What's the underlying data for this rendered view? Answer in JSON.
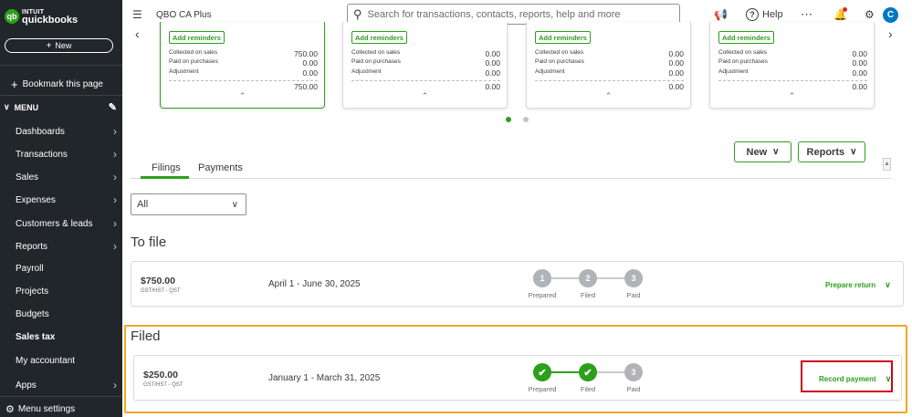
{
  "sidebar": {
    "logo_line1": "INTUIT",
    "logo_line2": "quickbooks",
    "logo_mark": "qb",
    "new_label": "New",
    "bookmark_label": "Bookmark this page",
    "menu_label": "MENU",
    "items": [
      {
        "label": "Dashboards",
        "has_arrow": true
      },
      {
        "label": "Transactions",
        "has_arrow": true
      },
      {
        "label": "Sales",
        "has_arrow": true
      },
      {
        "label": "Expenses",
        "has_arrow": true
      },
      {
        "label": "Customers & leads",
        "has_arrow": true
      },
      {
        "label": "Reports",
        "has_arrow": true
      },
      {
        "label": "Payroll",
        "has_arrow": false
      },
      {
        "label": "Projects",
        "has_arrow": false
      },
      {
        "label": "Budgets",
        "has_arrow": false
      },
      {
        "label": "Sales tax",
        "has_arrow": false,
        "active": true
      },
      {
        "label": "My accountant",
        "has_arrow": false
      },
      {
        "label": "Apps",
        "has_arrow": true
      }
    ],
    "menu_settings_label": "Menu settings"
  },
  "topbar": {
    "company": "QBO CA Plus",
    "search_placeholder": "Search for transactions, contacts, reports, help and more",
    "help_label": "Help",
    "avatar_initial": "C"
  },
  "cards": [
    {
      "reminders": "Add reminders",
      "collected_label": "Collected on sales",
      "collected": "750.00",
      "paid_label": "Paid on purchases",
      "paid": "0.00",
      "adjustment_label": "Adjustment",
      "adjustment": "0.00",
      "total": "750.00",
      "selected": true
    },
    {
      "reminders": "Add reminders",
      "collected_label": "Collected on sales",
      "collected": "0.00",
      "paid_label": "Paid on purchases",
      "paid": "0.00",
      "adjustment_label": "Adjustment",
      "adjustment": "0.00",
      "total": "0.00",
      "selected": false
    },
    {
      "reminders": "Add reminders",
      "collected_label": "Collected on sales",
      "collected": "0.00",
      "paid_label": "Paid on purchases",
      "paid": "0.00",
      "adjustment_label": "Adjustment",
      "adjustment": "0.00",
      "total": "0.00",
      "selected": false
    },
    {
      "reminders": "Add reminders",
      "collected_label": "Collected on sales",
      "collected": "0.00",
      "paid_label": "Paid on purchases",
      "paid": "0.00",
      "adjustment_label": "Adjustment",
      "adjustment": "0.00",
      "total": "0.00",
      "selected": false
    }
  ],
  "actions": {
    "new_label": "New",
    "reports_label": "Reports"
  },
  "tabs": [
    {
      "label": "Filings",
      "active": true
    },
    {
      "label": "Payments",
      "active": false
    }
  ],
  "filter": {
    "selected": "All"
  },
  "to_file": {
    "title": "To file",
    "amount": "$750.00",
    "tax_type": "GST/HST - QST",
    "period": "April 1 - June 30, 2025",
    "steps": [
      {
        "num": "1",
        "label": "Prepared",
        "done": false
      },
      {
        "num": "2",
        "label": "Filed",
        "done": false
      },
      {
        "num": "3",
        "label": "Paid",
        "done": false
      }
    ],
    "action": "Prepare return"
  },
  "filed": {
    "title": "Filed",
    "amount": "$250.00",
    "tax_type": "GST/HST - QST",
    "period": "January 1 - March 31, 2025",
    "steps": [
      {
        "num": "1",
        "label": "Prepared",
        "done": true
      },
      {
        "num": "2",
        "label": "Filed",
        "done": true
      },
      {
        "num": "3",
        "label": "Paid",
        "done": false
      }
    ],
    "action": "Record payment"
  },
  "colors": {
    "brand_green": "#2ca01c",
    "sidebar_bg": "#21262b",
    "highlight_orange": "#f5a623",
    "highlight_red": "#d0021b"
  }
}
